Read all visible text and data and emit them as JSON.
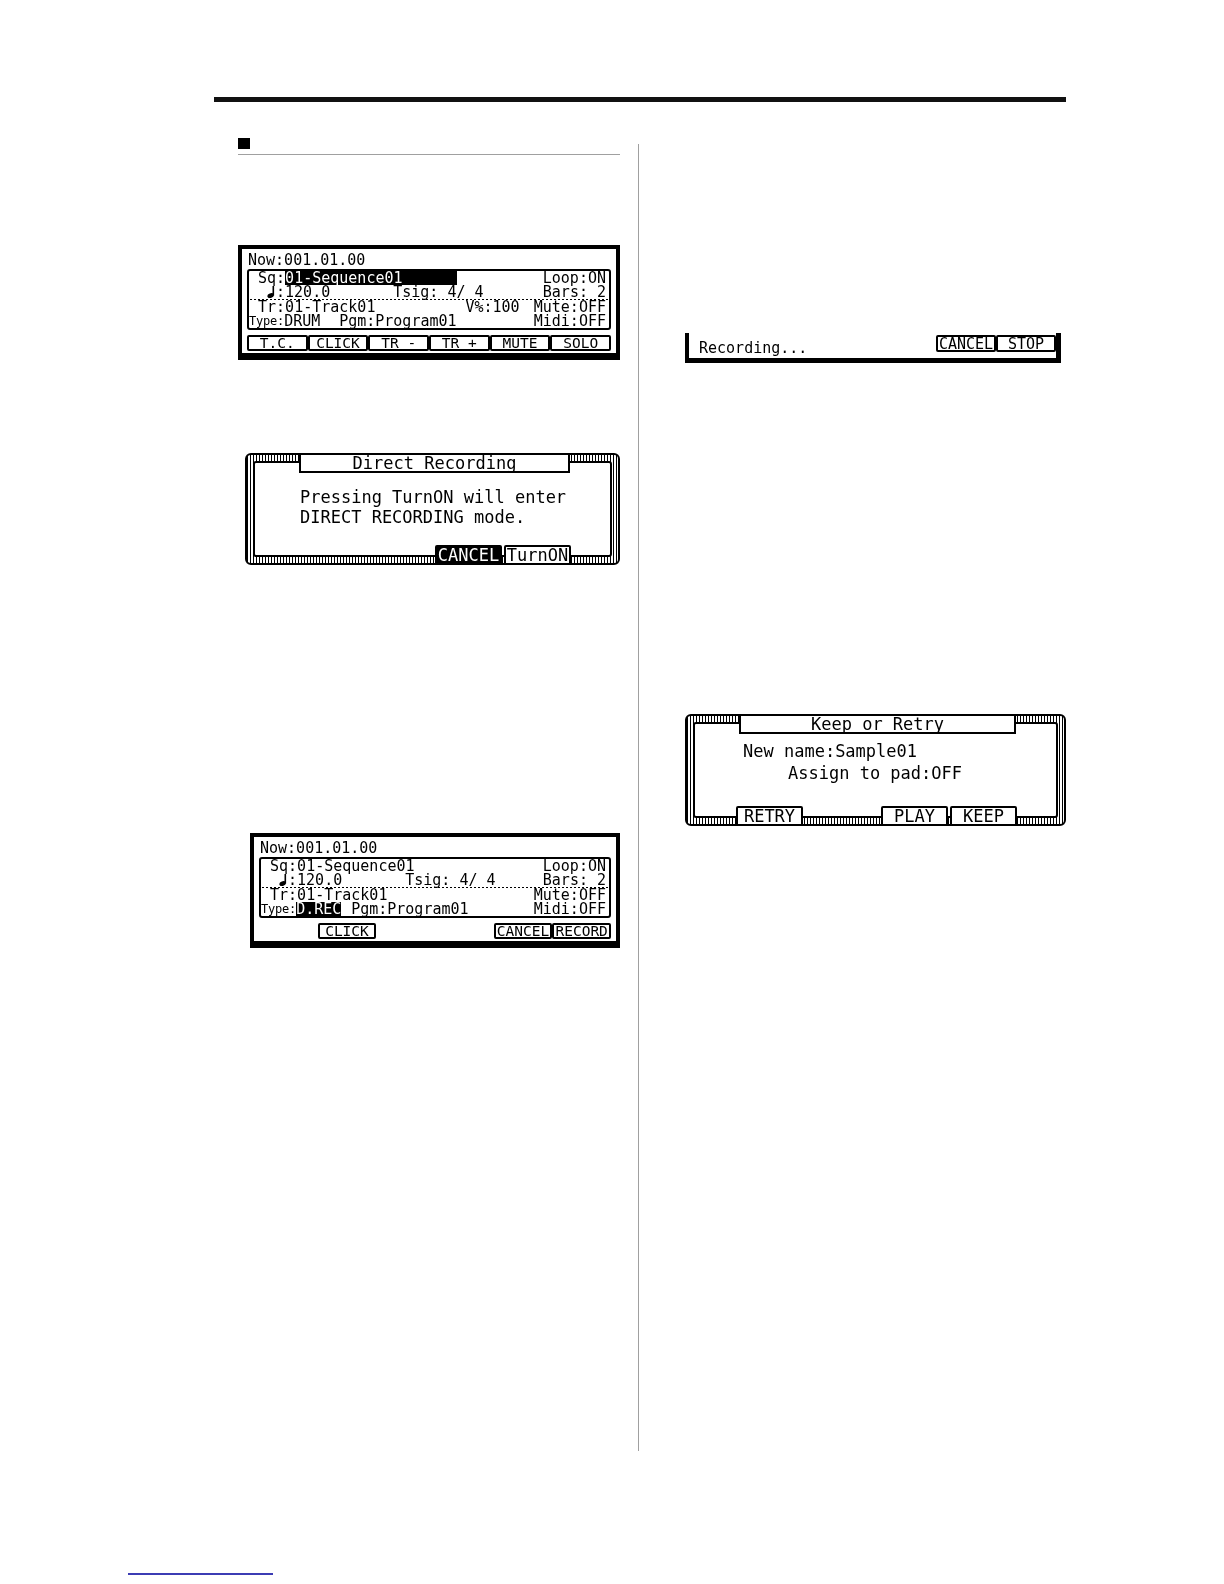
{
  "left_column": {
    "screens": [
      {
        "kind": "sequencer",
        "now": "Now:001.01.00",
        "sequence_rows": [
          {
            "fields": [
              {
                "kind": "name",
                "label": "Sq:",
                "value": "01-Sequence01",
                "selected": true
              },
              {
                "kind": "loop",
                "label": "Loop:",
                "value": "ON",
                "selected": false
              }
            ]
          },
          {
            "fields": [
              {
                "kind": "tempo",
                "label": ":",
                "value": "120.0",
                "selected": false
              },
              {
                "kind": "tsig",
                "label": "Tsig:",
                "value": "4/ 4",
                "selected": false
              },
              {
                "kind": "bars",
                "label": "Bars:",
                "value": "2",
                "selected": false
              }
            ]
          }
        ],
        "track_rows": [
          {
            "fields": [
              {
                "kind": "track",
                "label": "Tr:",
                "value": "01-Track01",
                "selected": false
              },
              {
                "kind": "velocity",
                "label": "V%:",
                "value": "100",
                "selected": false
              },
              {
                "kind": "mute",
                "label": "Mute:",
                "value": "OFF",
                "selected": false
              }
            ]
          },
          {
            "fields": [
              {
                "kind": "type",
                "label": "Type:",
                "value": "DRUM",
                "selected": false
              },
              {
                "kind": "program",
                "label": "Pgm:",
                "value": "Program01",
                "selected": false
              },
              {
                "kind": "midi",
                "label": "Midi:",
                "value": "OFF",
                "selected": false
              }
            ]
          }
        ],
        "soft_keys": [
          "T.C.",
          "CLICK",
          "TR -",
          "TR +",
          "MUTE",
          "SOLO"
        ]
      },
      {
        "kind": "dialog",
        "title": "Direct Recording",
        "message": "Pressing TurnON will enter DIRECT RECORDING mode.",
        "buttons": [
          {
            "label": "CANCEL",
            "selected": true
          },
          {
            "label": "TurnON",
            "selected": false
          }
        ]
      },
      {
        "kind": "sequencer",
        "now": "Now:001.01.00",
        "sequence_rows": [
          {
            "fields": [
              {
                "kind": "name",
                "label": "Sq:",
                "value": "01-Sequence01",
                "selected": false
              },
              {
                "kind": "loop",
                "label": "Loop:",
                "value": "ON",
                "selected": false
              }
            ]
          },
          {
            "fields": [
              {
                "kind": "tempo",
                "label": ":",
                "value": "120.0",
                "selected": false
              },
              {
                "kind": "tsig",
                "label": "Tsig:",
                "value": "4/ 4",
                "selected": false
              },
              {
                "kind": "bars",
                "label": "Bars:",
                "value": "2",
                "selected": false
              }
            ]
          }
        ],
        "track_rows": [
          {
            "fields": [
              {
                "kind": "track",
                "label": "Tr:",
                "value": "01-Track01",
                "selected": false
              },
              {
                "kind": "mute",
                "label": "Mute:",
                "value": "OFF",
                "selected": false
              }
            ]
          },
          {
            "fields": [
              {
                "kind": "type",
                "label": "Type:",
                "value": "D.REC",
                "selected": true
              },
              {
                "kind": "program",
                "label": "Pgm:",
                "value": "Program01",
                "selected": false
              },
              {
                "kind": "midi",
                "label": "Midi:",
                "value": "OFF",
                "selected": false
              }
            ]
          }
        ],
        "soft_keys": [
          "CLICK",
          "CANCEL",
          "RECORD"
        ]
      }
    ]
  },
  "right_column": {
    "screens": [
      {
        "kind": "status_bar",
        "message": "Recording...",
        "soft_keys": [
          "CANCEL",
          "STOP"
        ]
      },
      {
        "kind": "dialog",
        "title": "Keep or Retry",
        "fields": [
          {
            "kind": "name",
            "label": "New name:",
            "value": "Sample01"
          },
          {
            "kind": "assign",
            "label": "Assign to pad:",
            "value": "OFF"
          }
        ],
        "buttons": [
          {
            "label": "RETRY",
            "selected": false
          },
          {
            "label": "PLAY",
            "selected": false
          },
          {
            "label": "KEEP",
            "selected": false
          }
        ]
      }
    ]
  }
}
